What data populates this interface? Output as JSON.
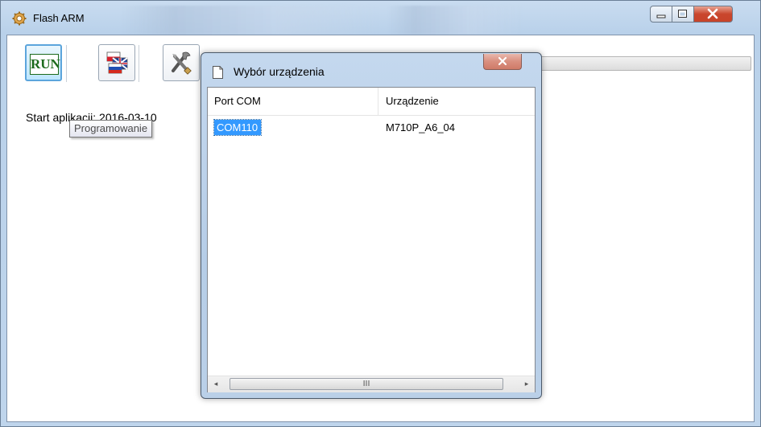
{
  "app": {
    "title": "Flash ARM",
    "icon": "gear-icon"
  },
  "window_controls": {
    "minimize": "—",
    "maximize": "☐",
    "close": "X"
  },
  "toolbar": {
    "run_label": "RUN",
    "flags_icon": "language-flags-icon",
    "tools_icon": "tools-icon"
  },
  "log": {
    "text": "Start aplikacji: 2016-03-10"
  },
  "tooltip": {
    "text": "Programowanie"
  },
  "dialog": {
    "title": "Wybór urządzenia",
    "close": "X",
    "columns": [
      "Port COM",
      "Urządzenie"
    ],
    "rows": [
      {
        "port": "COM110",
        "device": "M710P_A6_04",
        "selected": true
      }
    ],
    "scroll": {
      "left": "◂",
      "right": "▸",
      "grip": "III"
    }
  },
  "colors": {
    "selection": "#3399ff",
    "close_red": "#c8432a",
    "run_green": "#1d6b1d"
  }
}
